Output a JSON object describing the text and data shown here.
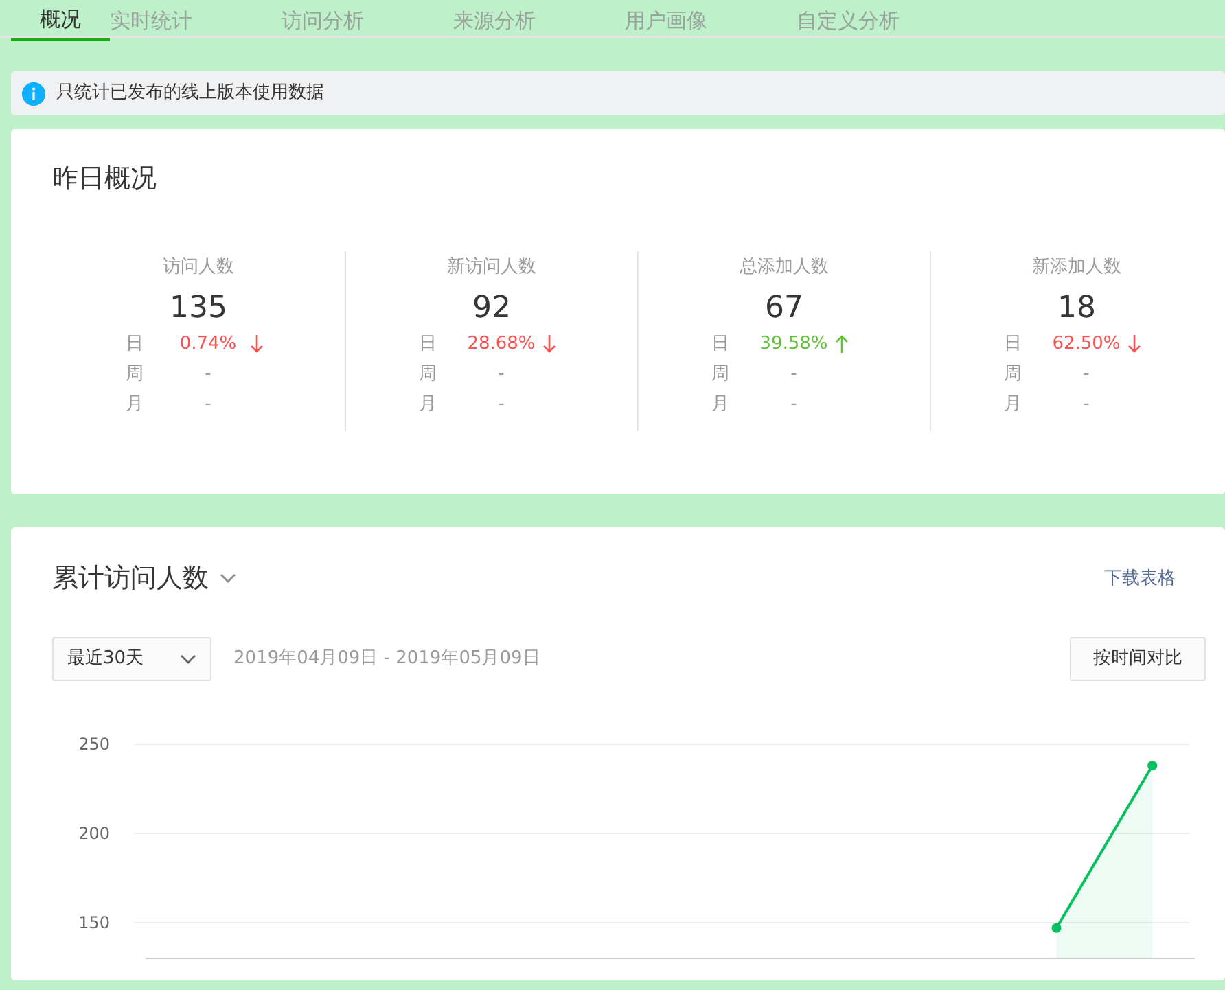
{
  "tabs": [
    {
      "label": "概况",
      "selected": true
    },
    {
      "label": "实时统计",
      "selected": false
    },
    {
      "label": "访问分析",
      "selected": false
    },
    {
      "label": "来源分析",
      "selected": false
    },
    {
      "label": "用户画像",
      "selected": false
    },
    {
      "label": "自定义分析",
      "selected": false
    }
  ],
  "notice": {
    "text": "只统计已发布的线上版本使用数据"
  },
  "yesterday": {
    "title": "昨日概况",
    "stats": [
      {
        "label": "访问人数",
        "value": "135",
        "rows": [
          {
            "period": "日",
            "change": "0.74%",
            "rising": false
          },
          {
            "period": "周",
            "change": "-"
          },
          {
            "period": "月",
            "change": "-"
          }
        ]
      },
      {
        "label": "新访问人数",
        "value": "92",
        "rows": [
          {
            "period": "日",
            "change": "28.68%",
            "rising": false
          },
          {
            "period": "周",
            "change": "-"
          },
          {
            "period": "月",
            "change": "-"
          }
        ]
      },
      {
        "label": "总添加人数",
        "value": "67",
        "rows": [
          {
            "period": "日",
            "change": "39.58%",
            "rising": true
          },
          {
            "period": "周",
            "change": "-"
          },
          {
            "period": "月",
            "change": "-"
          }
        ]
      },
      {
        "label": "新添加人数",
        "value": "18",
        "rows": [
          {
            "period": "日",
            "change": "62.50%",
            "rising": false
          },
          {
            "period": "周",
            "change": "-"
          },
          {
            "period": "月",
            "change": "-"
          }
        ]
      }
    ]
  },
  "trend": {
    "download": "下载表格",
    "range_select": "最近30天",
    "date_range": "2019年04月09日 - 2019年05月09日",
    "compare_button": "按时间对比",
    "chart_data": {
      "type": "area",
      "title": "累计访问人数",
      "ylim": [
        130,
        250
      ],
      "yticks": [
        150,
        200,
        250
      ],
      "series": [
        {
          "color": "#07c160",
          "values": [
            null,
            null,
            null,
            null,
            null,
            null,
            null,
            null,
            null,
            147,
            238
          ]
        }
      ]
    }
  }
}
